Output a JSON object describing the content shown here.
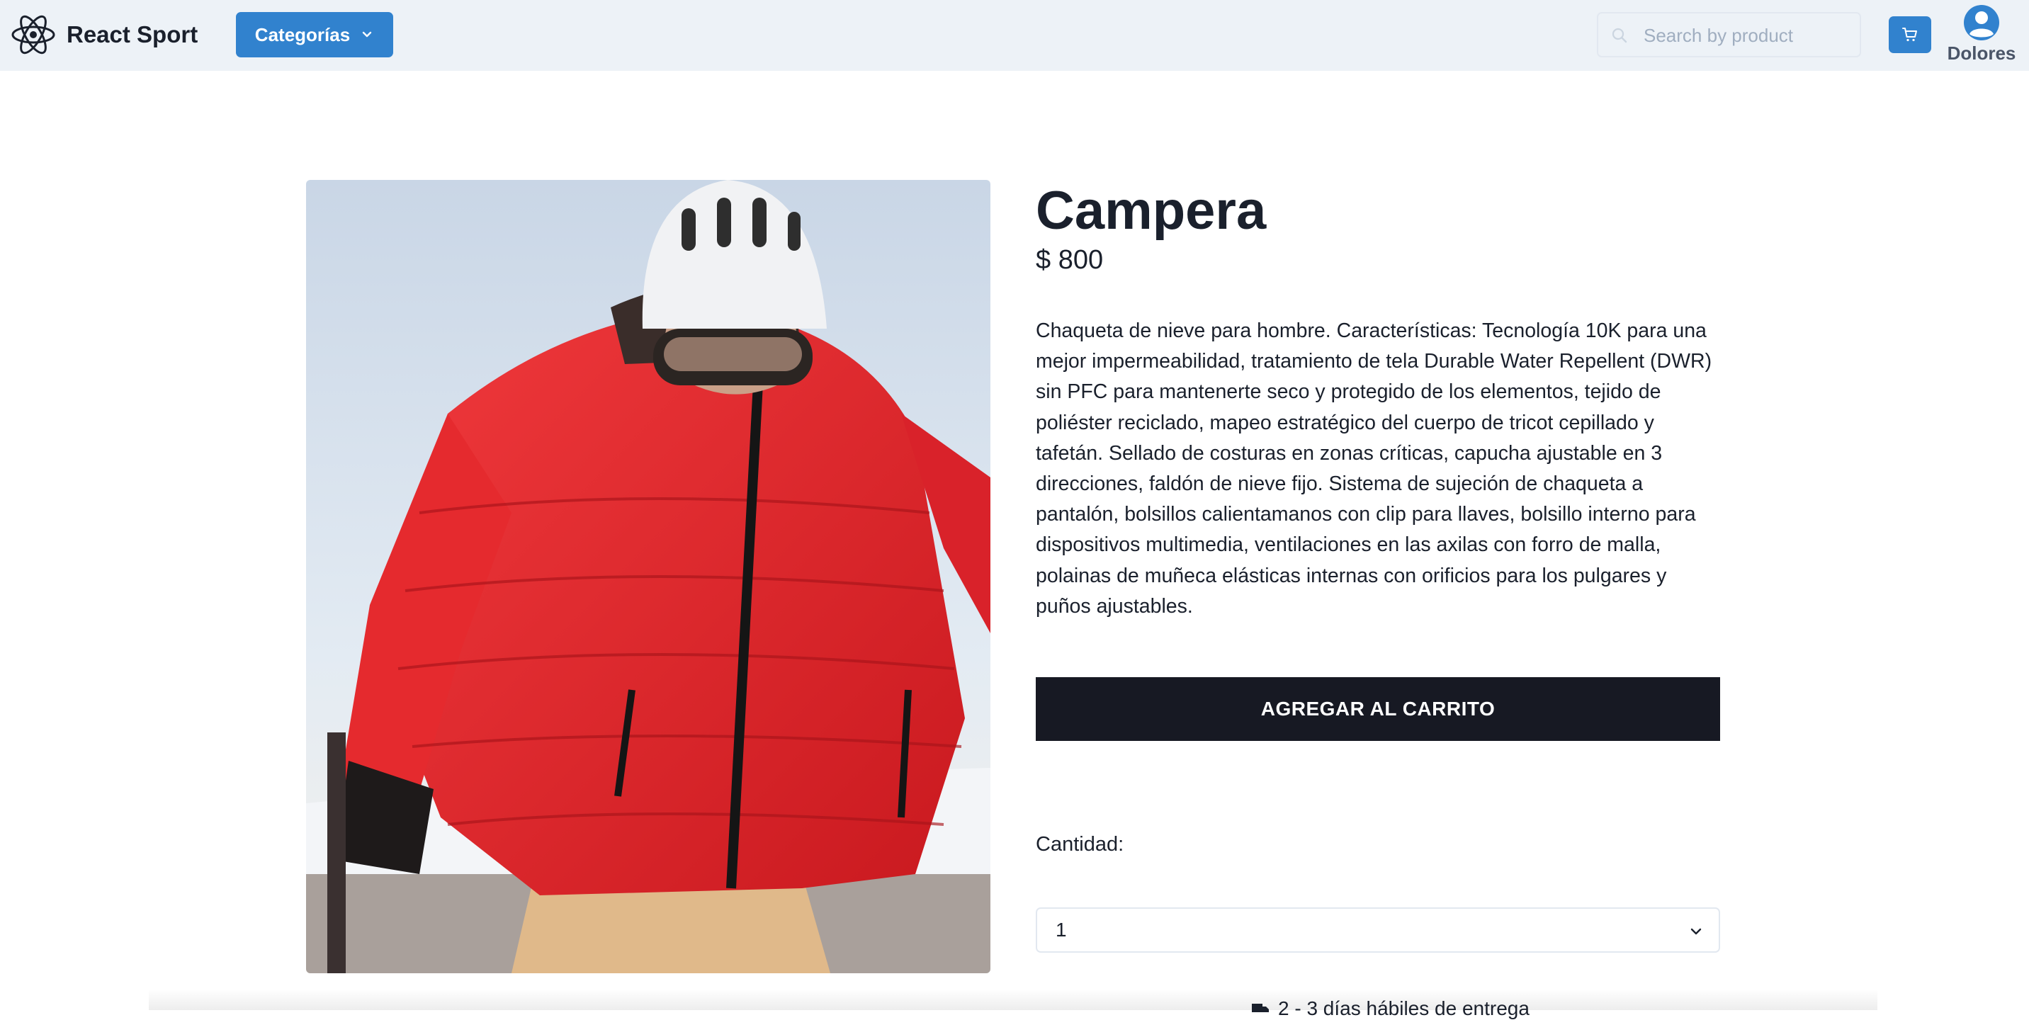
{
  "header": {
    "brand": "React Sport",
    "categories_label": "Categorías",
    "search_placeholder": "Search by product",
    "cart_icon": "cart-icon",
    "user_icon": "user-circle-icon",
    "user_name": "Dolores"
  },
  "product": {
    "title": "Campera",
    "price": "$ 800",
    "description": "Chaqueta de nieve para hombre. Características: Tecnología 10K para una mejor impermeabilidad, tratamiento de tela Durable Water Repellent (DWR) sin PFC para mantenerte seco y protegido de los elementos, tejido de poliéster reciclado, mapeo estratégico del cuerpo de tricot cepillado y tafetán. Sellado de costuras en zonas críticas, capucha ajustable en 3 direcciones, faldón de nieve fijo. Sistema de sujeción de chaqueta a pantalón, bolsillos calientamanos con clip para llaves, bolsillo interno para dispositivos multimedia, ventilaciones en las axilas con forro de malla, polainas de muñeca elásticas internas con orificios para los pulgares y puños ajustables.",
    "add_to_cart_label": "AGREGAR AL CARRITO",
    "quantity_label": "Cantidad:",
    "quantity_value": "1",
    "delivery_text": "2 - 3 días hábiles de entrega"
  },
  "colors": {
    "navbar_bg": "#edf2f7",
    "accent": "#3182ce",
    "dark_button": "#171923"
  }
}
